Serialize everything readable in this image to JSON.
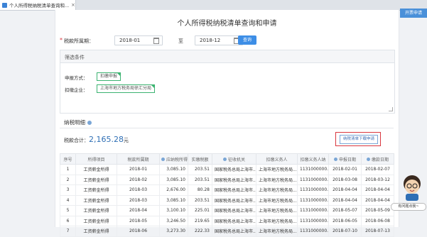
{
  "tab": {
    "title": "个人所得税纳税清单查询和...",
    "close": "×"
  },
  "corner_button": "开票申请",
  "page_title": "个人所得税纳税清单查询和申请",
  "period": {
    "label": "税款所属期：",
    "start": "2018-01",
    "to": "至",
    "end": "2018-12",
    "query_label": "查询"
  },
  "filter": {
    "title": "筛选条件",
    "mode_label": "申报方式：",
    "mode_value": "扣缴申报",
    "withholder_label": "扣缴企业：",
    "withholder_value": "上海市地方税务局徐汇分局"
  },
  "detail": {
    "title": "纳税明细",
    "total_label": "税款合计：",
    "total_amount": "2,165.28",
    "total_unit": "元",
    "export_label": "纳税清单下载申请"
  },
  "table": {
    "headers": [
      "序号",
      "所得项目",
      "税款所属期",
      "应纳税所得",
      "实缴税额",
      "征收机关",
      "扣缴义务人",
      "扣缴义务人纳",
      "申报日期",
      "缴款日期"
    ],
    "rows": [
      [
        "1",
        "工资薪金所得",
        "2018-01",
        "3,085.10",
        "203.51",
        "国家税务总局上海市...",
        "上海市地方税务局...",
        "1131000000...",
        "2018-02-01",
        "2018-02-07"
      ],
      [
        "2",
        "工资薪金所得",
        "2018-02",
        "3,085.10",
        "203.51",
        "国家税务总局上海市...",
        "上海市地方税务局...",
        "1131000000...",
        "2018-03-08",
        "2018-03-12"
      ],
      [
        "3",
        "工资薪金所得",
        "2018-03",
        "2,676.00",
        "80.28",
        "国家税务总局上海市...",
        "上海市地方税务局...",
        "1131000000...",
        "2018-04-04",
        "2018-04-04"
      ],
      [
        "4",
        "工资薪金所得",
        "2018-03",
        "3,085.10",
        "203.51",
        "国家税务总局上海市...",
        "上海市地方税务局...",
        "1131000000...",
        "2018-04-04",
        "2018-04-04"
      ],
      [
        "5",
        "工资薪金所得",
        "2018-04",
        "3,100.10",
        "225.01",
        "国家税务总局上海市...",
        "上海市地方税务局...",
        "1131000000...",
        "2018-05-07",
        "2018-05-09"
      ],
      [
        "6",
        "工资薪金所得",
        "2018-05",
        "3,246.50",
        "219.65",
        "国家税务总局上海市...",
        "上海市地方税务局...",
        "1131000000...",
        "2018-06-05",
        "2018-06-08"
      ],
      [
        "7",
        "工资薪金所得",
        "2018-06",
        "3,273.30",
        "222.33",
        "国家税务总局上海市...",
        "上海市地方税务局...",
        "1131000000...",
        "2018-07-10",
        "2018-07-13"
      ]
    ]
  },
  "assistant": {
    "label": "有问题点我~"
  },
  "colors": {
    "accent": "#3d8ee6",
    "highlight_border": "#d9363e",
    "tag_green": "#3cb371"
  },
  "icons": [
    "tab-page-icon",
    "calendar-icon",
    "info-icon",
    "resize-handle-icon",
    "assistant-mascot-icon"
  ]
}
